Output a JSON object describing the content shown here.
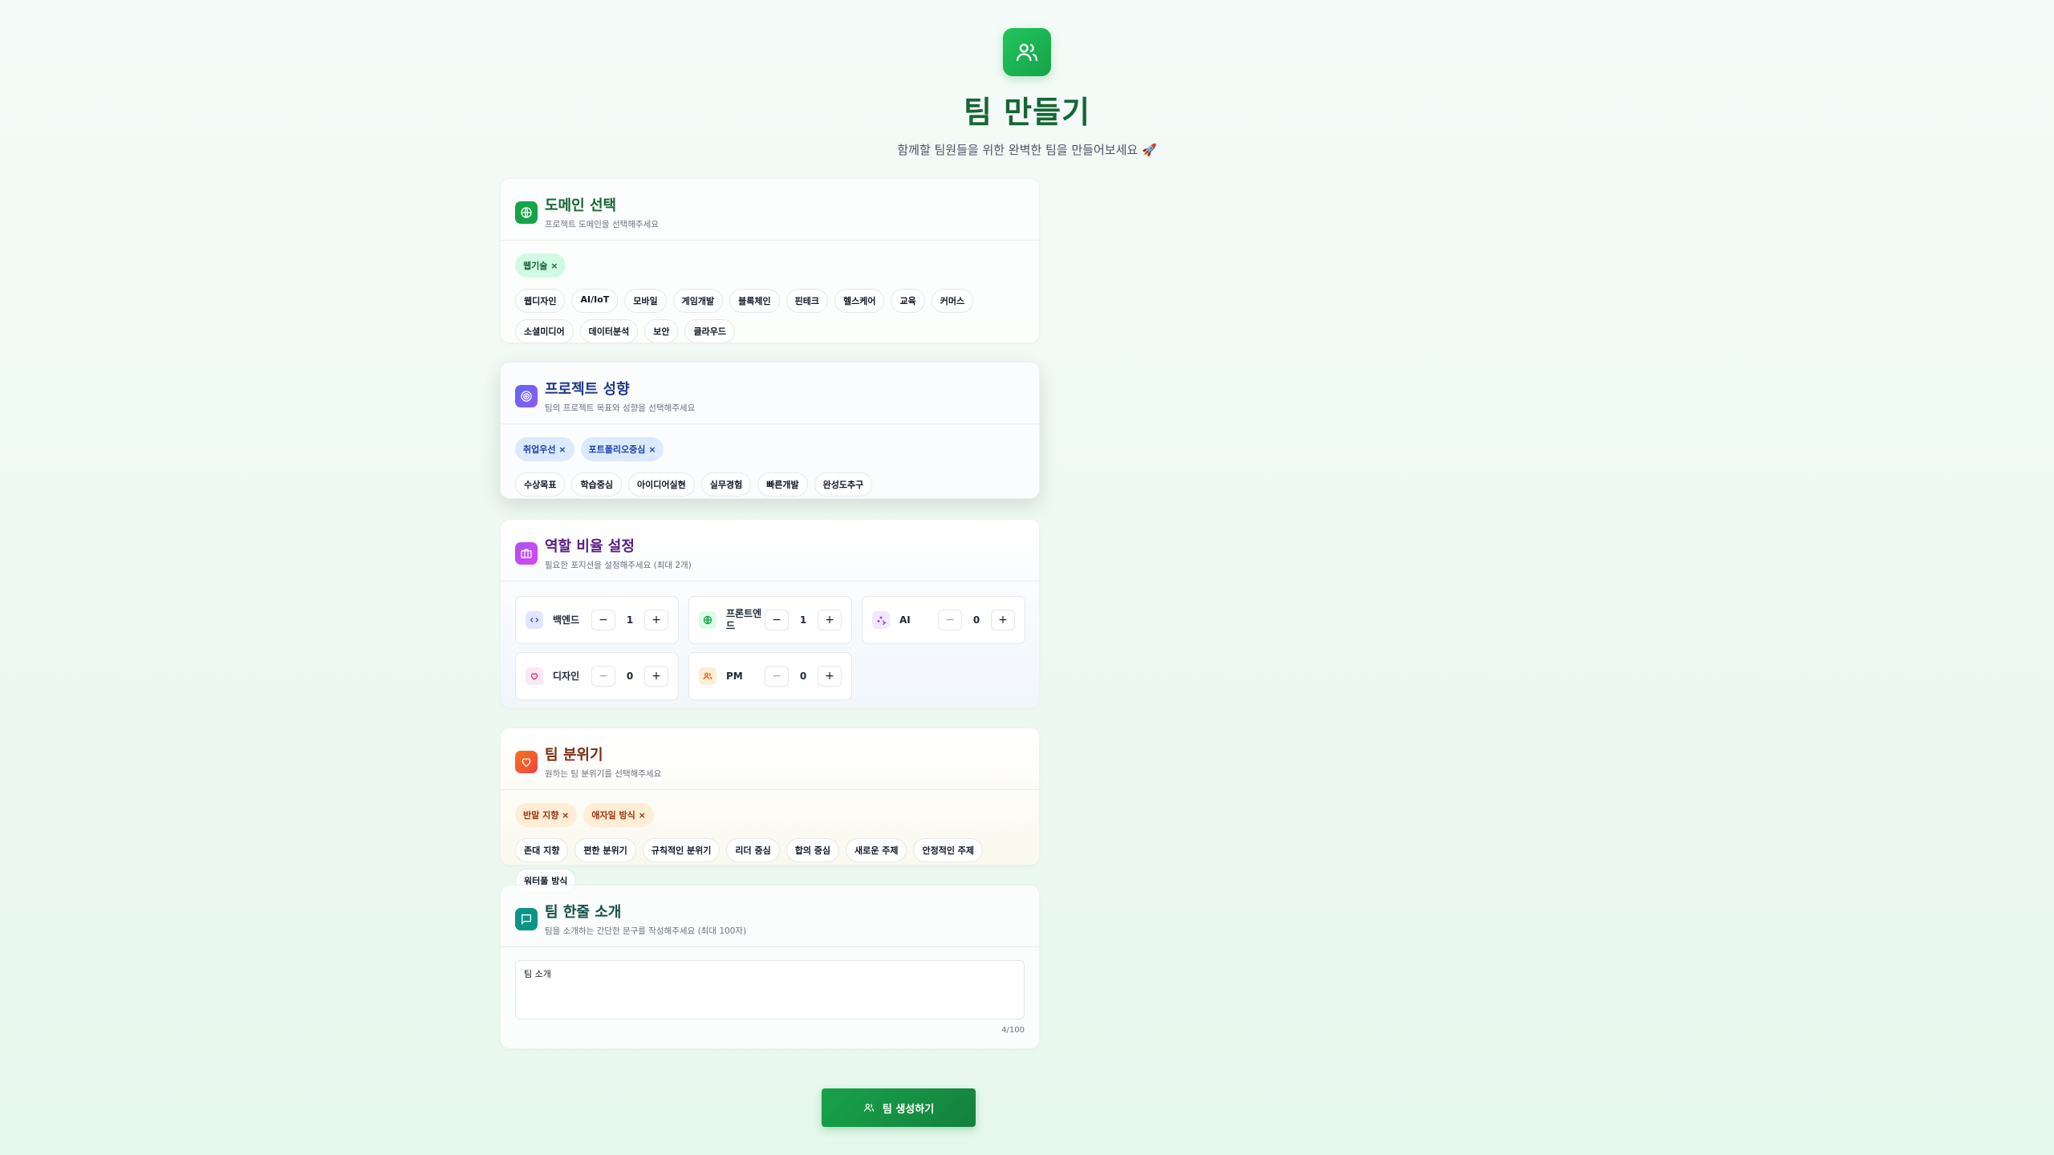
{
  "header": {
    "title": "팀 만들기",
    "subtitle": "함께할 팀원들을 위한 완벽한 팀을 만들어보세요 🚀"
  },
  "domain": {
    "title": "도메인 선택",
    "subtitle": "프로젝트 도메인을 선택해주세요",
    "selected": [
      "웹기술 ×"
    ],
    "options": [
      "웹디자인",
      "AI/IoT",
      "모바일",
      "게임개발",
      "블록체인",
      "핀테크",
      "헬스케어",
      "교육",
      "커머스",
      "소셜미디어",
      "데이터분석",
      "보안",
      "클라우드"
    ]
  },
  "tendency": {
    "title": "프로젝트 성향",
    "subtitle": "팀의 프로젝트 목표와 성향을 선택해주세요",
    "selected": [
      "취업우선 ×",
      "포트폴리오중심 ×"
    ],
    "options": [
      "수상목표",
      "학습중심",
      "아이디어실현",
      "실무경험",
      "빠른개발",
      "완성도추구"
    ]
  },
  "roles": {
    "title": "역할 비율 설정",
    "subtitle": "필요한 포지션을 설정해주세요 (최대 2개)",
    "items": [
      {
        "label": "백엔드",
        "value": "1"
      },
      {
        "label": "프론트엔드",
        "value": "1"
      },
      {
        "label": "AI",
        "value": "0"
      },
      {
        "label": "디자인",
        "value": "0"
      },
      {
        "label": "PM",
        "value": "0"
      }
    ],
    "minus": "−",
    "plus": "+"
  },
  "mood": {
    "title": "팀 분위기",
    "subtitle": "원하는 팀 분위기를 선택해주세요",
    "selected": [
      "반말 지향 ×",
      "애자일 방식 ×"
    ],
    "options": [
      "존대 지향",
      "편한 분위기",
      "규칙적인 분위기",
      "리더 중심",
      "합의 중심",
      "새로운 주제",
      "안정적인 주제",
      "워터풀 방식"
    ]
  },
  "intro": {
    "title": "팀 한줄 소개",
    "subtitle": "팀을 소개하는 간단한 문구를 작성해주세요 (최대 100자)",
    "value": "팀 소개",
    "counter": "4/100"
  },
  "submit": {
    "label": "팀 생성하기"
  }
}
